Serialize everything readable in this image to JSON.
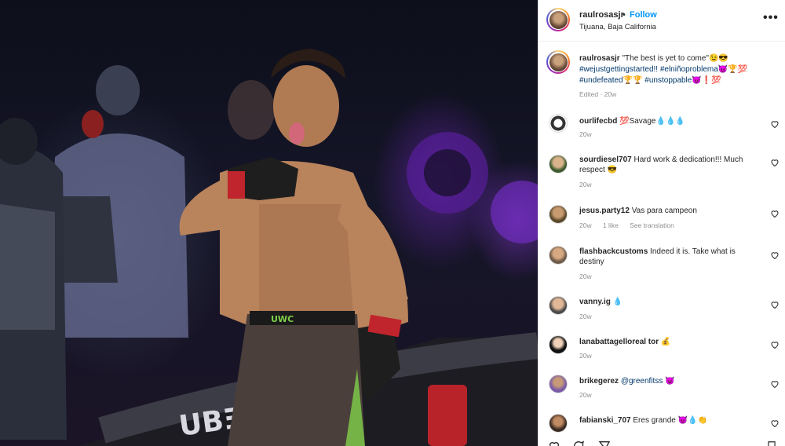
{
  "post": {
    "username": "raulrosasjr",
    "follow_label": "Follow",
    "separator": "•",
    "location": "Tijuana, Baja California",
    "more_icon": "more-horizontal-icon"
  },
  "caption": {
    "username": "raulrosasjr",
    "quote": " \"The best is yet to come\"😉😎",
    "tags_line1": "#wejustgettingstarted!! #elniñoproblema😈🏆💯",
    "tags_line2": "#undefeated🏆🏆 #unstoppable😈❗💯",
    "meta": "Edited · 20w"
  },
  "comments": [
    {
      "username": "ourlifecbd",
      "text": " 💯Savage💧💧💧",
      "time": "20w",
      "likes": "",
      "translate": ""
    },
    {
      "username": "sourdiesel707",
      "text": " Hard work & dedication!!! Much respect 😎",
      "time": "20w",
      "likes": "",
      "translate": ""
    },
    {
      "username": "jesus.party12",
      "text": " Vas para campeon",
      "time": "20w",
      "likes": "1 like",
      "translate": "See translation"
    },
    {
      "username": "flashbackcustoms",
      "text": " Indeed it is. Take what is destiny",
      "time": "20w",
      "likes": "",
      "translate": ""
    },
    {
      "username": "vanny.ig",
      "text": " 💧",
      "time": "20w",
      "likes": "",
      "translate": ""
    },
    {
      "username": "lanabattagelloreal tor",
      "text": " 💰",
      "time": "20w",
      "likes": "",
      "translate": ""
    },
    {
      "username": "brikegerez",
      "text": " ",
      "mention": "@greenfitss",
      "after": " 😈",
      "time": "20w",
      "likes": "",
      "translate": ""
    },
    {
      "username": "fabianski_707",
      "text": " Eres grande 😈💧👏",
      "time": "",
      "likes": "",
      "translate": ""
    }
  ],
  "colors": {
    "accent": "#0095f6",
    "mention": "#00376b",
    "meta": "#8e8e8e",
    "text": "#262626"
  },
  "icons": [
    "heart-icon",
    "comment-icon",
    "share-icon",
    "bookmark-icon"
  ]
}
